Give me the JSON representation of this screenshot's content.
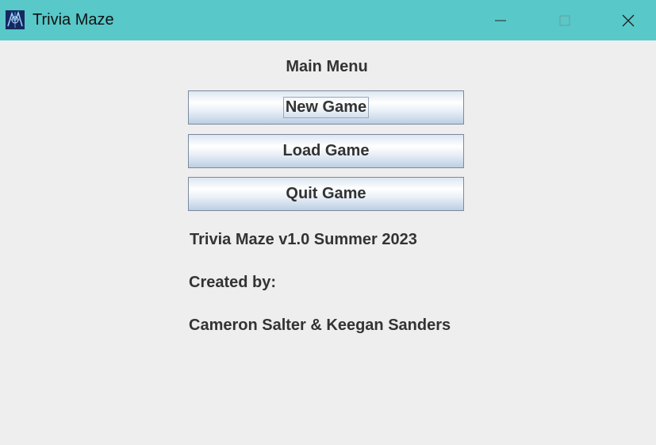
{
  "window": {
    "title": "Trivia Maze",
    "titlebar_color": "#58c8c9",
    "icons": {
      "app": "trivia-maze-app-icon",
      "minimize": "minimize-icon",
      "maximize": "maximize-icon",
      "close": "close-icon"
    }
  },
  "menu": {
    "heading": "Main Menu",
    "buttons": [
      {
        "label": "New Game",
        "focused": true
      },
      {
        "label": "Load Game",
        "focused": false
      },
      {
        "label": "Quit Game",
        "focused": false
      }
    ]
  },
  "info": {
    "version": "Trivia Maze v1.0 Summer 2023",
    "created_label": "Created by:",
    "authors": "Cameron Salter & Keegan Sanders"
  }
}
